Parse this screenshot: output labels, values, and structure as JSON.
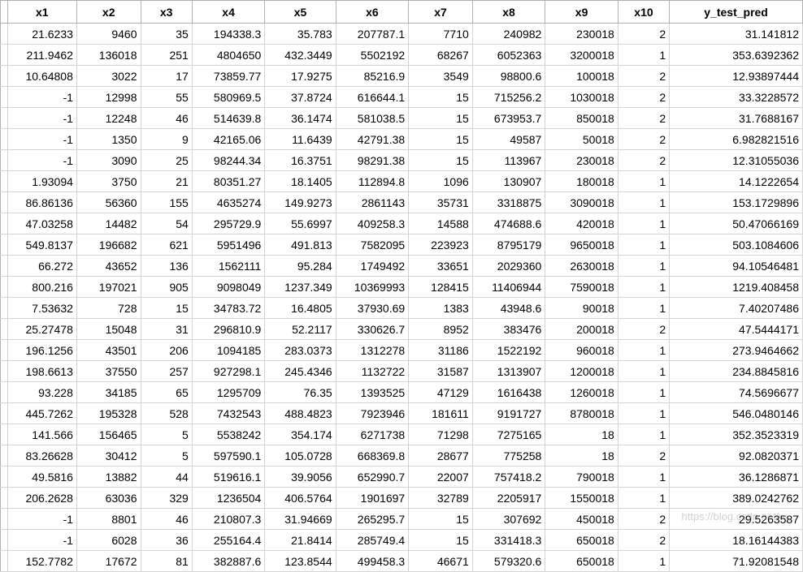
{
  "chart_data": {
    "type": "table",
    "headers": [
      "x1",
      "x2",
      "x3",
      "x4",
      "x5",
      "x6",
      "x7",
      "x8",
      "x9",
      "x10",
      "y_test_pred"
    ],
    "rows": [
      [
        "21.6233",
        "9460",
        "35",
        "194338.3",
        "35.783",
        "207787.1",
        "7710",
        "240982",
        "230018",
        "2",
        "31.141812"
      ],
      [
        "211.9462",
        "136018",
        "251",
        "4804650",
        "432.3449",
        "5502192",
        "68267",
        "6052363",
        "3200018",
        "1",
        "353.6392362"
      ],
      [
        "10.64808",
        "3022",
        "17",
        "73859.77",
        "17.9275",
        "85216.9",
        "3549",
        "98800.6",
        "100018",
        "2",
        "12.93897444"
      ],
      [
        "-1",
        "12998",
        "55",
        "580969.5",
        "37.8724",
        "616644.1",
        "15",
        "715256.2",
        "1030018",
        "2",
        "33.3228572"
      ],
      [
        "-1",
        "12248",
        "46",
        "514639.8",
        "36.1474",
        "581038.5",
        "15",
        "673953.7",
        "850018",
        "2",
        "31.7688167"
      ],
      [
        "-1",
        "1350",
        "9",
        "42165.06",
        "11.6439",
        "42791.38",
        "15",
        "49587",
        "50018",
        "2",
        "6.982821516"
      ],
      [
        "-1",
        "3090",
        "25",
        "98244.34",
        "16.3751",
        "98291.38",
        "15",
        "113967",
        "230018",
        "2",
        "12.31055036"
      ],
      [
        "1.93094",
        "3750",
        "21",
        "80351.27",
        "18.1405",
        "112894.8",
        "1096",
        "130907",
        "180018",
        "1",
        "14.1222654"
      ],
      [
        "86.86136",
        "56360",
        "155",
        "4635274",
        "149.9273",
        "2861143",
        "35731",
        "3318875",
        "3090018",
        "1",
        "153.1729896"
      ],
      [
        "47.03258",
        "14482",
        "54",
        "295729.9",
        "55.6997",
        "409258.3",
        "14588",
        "474688.6",
        "420018",
        "1",
        "50.47066169"
      ],
      [
        "549.8137",
        "196682",
        "621",
        "5951496",
        "491.813",
        "7582095",
        "223923",
        "8795179",
        "9650018",
        "1",
        "503.1084606"
      ],
      [
        "66.272",
        "43652",
        "136",
        "1562111",
        "95.284",
        "1749492",
        "33651",
        "2029360",
        "2630018",
        "1",
        "94.10546481"
      ],
      [
        "800.216",
        "197021",
        "905",
        "9098049",
        "1237.349",
        "10369993",
        "128415",
        "11406944",
        "7590018",
        "1",
        "1219.408458"
      ],
      [
        "7.53632",
        "728",
        "15",
        "34783.72",
        "16.4805",
        "37930.69",
        "1383",
        "43948.6",
        "90018",
        "1",
        "7.40207486"
      ],
      [
        "25.27478",
        "15048",
        "31",
        "296810.9",
        "52.2117",
        "330626.7",
        "8952",
        "383476",
        "200018",
        "2",
        "47.5444171"
      ],
      [
        "196.1256",
        "43501",
        "206",
        "1094185",
        "283.0373",
        "1312278",
        "31186",
        "1522192",
        "960018",
        "1",
        "273.9464662"
      ],
      [
        "198.6613",
        "37550",
        "257",
        "927298.1",
        "245.4346",
        "1132722",
        "31587",
        "1313907",
        "1200018",
        "1",
        "234.8845816"
      ],
      [
        "93.228",
        "34185",
        "65",
        "1295709",
        "76.35",
        "1393525",
        "47129",
        "1616438",
        "1260018",
        "1",
        "74.5696677"
      ],
      [
        "445.7262",
        "195328",
        "528",
        "7432543",
        "488.4823",
        "7923946",
        "181611",
        "9191727",
        "8780018",
        "1",
        "546.0480146"
      ],
      [
        "141.566",
        "156465",
        "5",
        "5538242",
        "354.174",
        "6271738",
        "71298",
        "7275165",
        "18",
        "1",
        "352.3523319"
      ],
      [
        "83.26628",
        "30412",
        "5",
        "597590.1",
        "105.0728",
        "668369.8",
        "28677",
        "775258",
        "18",
        "2",
        "92.0820371"
      ],
      [
        "49.5816",
        "13882",
        "44",
        "519616.1",
        "39.9056",
        "652990.7",
        "22007",
        "757418.2",
        "790018",
        "1",
        "36.1286871"
      ],
      [
        "206.2628",
        "63036",
        "329",
        "1236504",
        "406.5764",
        "1901697",
        "32789",
        "2205917",
        "1550018",
        "1",
        "389.0242762"
      ],
      [
        "-1",
        "8801",
        "46",
        "210807.3",
        "31.94669",
        "265295.7",
        "15",
        "307692",
        "450018",
        "2",
        "29.5263587"
      ],
      [
        "-1",
        "6028",
        "36",
        "255164.4",
        "21.8414",
        "285749.4",
        "15",
        "331418.3",
        "650018",
        "2",
        "18.16144383"
      ],
      [
        "152.7782",
        "17672",
        "81",
        "382887.6",
        "123.8544",
        "499458.3",
        "46671",
        "579320.6",
        "650018",
        "1",
        "71.92081548"
      ]
    ]
  },
  "watermark": "https://blog.csdn.net/w..."
}
